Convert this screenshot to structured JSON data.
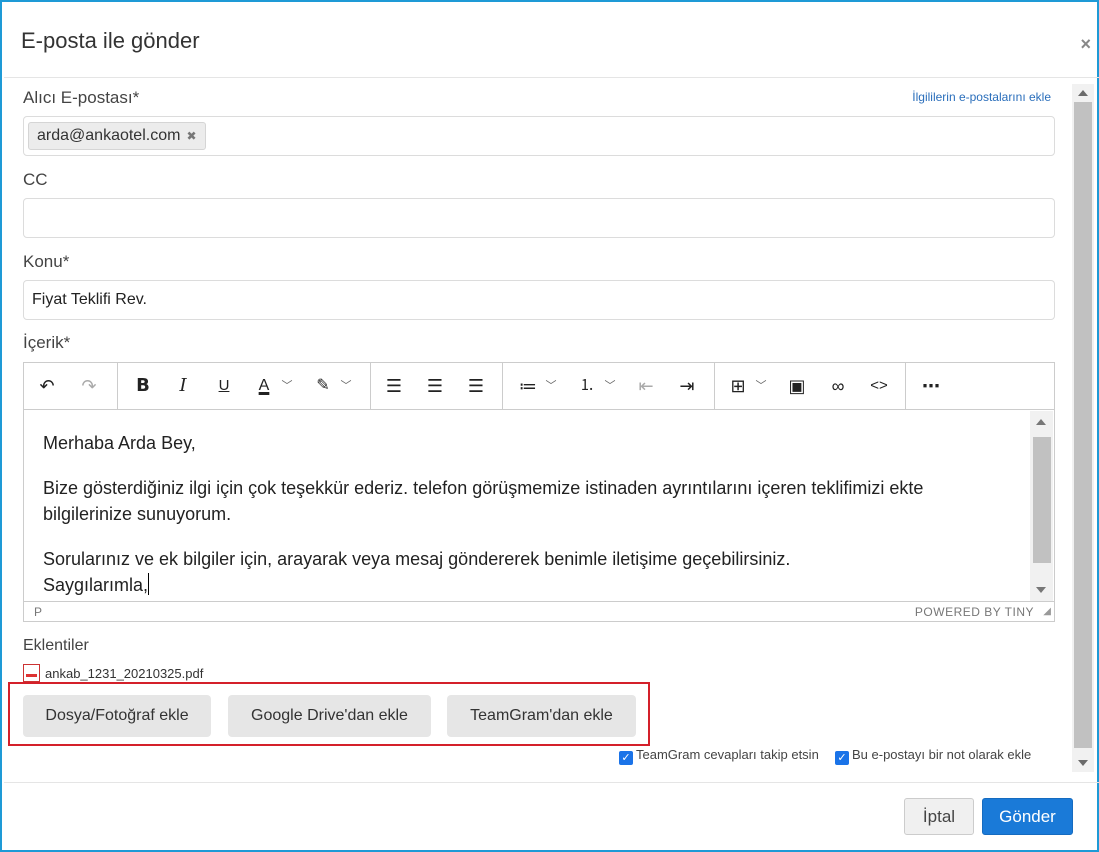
{
  "dialog": {
    "title": "E-posta ile gönder",
    "close_icon": "×"
  },
  "form": {
    "recipient_label": "Alıcı E-postası*",
    "add_related_link": "İlgililerin e-postalarını ekle",
    "recipient_chip": "arda@ankaotel.com",
    "recipient_chip_remove": "✖",
    "cc_label": "CC",
    "cc_value": "",
    "subject_label": "Konu*",
    "subject_value": "Fiyat Teklifi Rev.",
    "content_label": "İçerik*"
  },
  "editor": {
    "toolbar_icons": [
      "undo-icon",
      "redo-icon",
      "bold-icon",
      "italic-icon",
      "underline-icon",
      "text-color-icon",
      "highlight-icon",
      "align-left-icon",
      "align-center-icon",
      "align-right-icon",
      "bullet-list-icon",
      "numbered-list-icon",
      "outdent-icon",
      "indent-icon",
      "table-icon",
      "image-icon",
      "link-icon",
      "code-icon",
      "more-icon"
    ],
    "paragraphs": [
      "Merhaba Arda Bey,",
      "Bize gösterdiğiniz ilgi için çok teşekkür ederiz. telefon görüşmemize istinaden ayrıntılarını içeren teklifimizi ekte bilgilerinize sunuyorum."
    ],
    "closing_line1": "Sorularınız ve ek bilgiler için, arayarak veya mesaj göndererek benimle iletişime geçebilirsiniz.",
    "closing_line2": "Saygılarımla,",
    "status_path": "P",
    "powered_by": "POWERED BY TINY"
  },
  "attachments": {
    "label": "Eklentiler",
    "file_name": "ankab_1231_20210325.pdf",
    "buttons": {
      "file_photo": "Dosya/Fotoğraf ekle",
      "google_drive": "Google Drive'dan ekle",
      "teamgram": "TeamGram'dan ekle"
    }
  },
  "options": {
    "track_replies": "TeamGram cevapları takip etsin",
    "add_as_note": "Bu e-postayı bir not olarak ekle",
    "track_replies_checked": true,
    "add_as_note_checked": true
  },
  "footer": {
    "cancel": "İptal",
    "send": "Gönder"
  },
  "colors": {
    "accent": "#1a7ad8",
    "highlight_border": "#d4202a",
    "modal_border": "#1e9ad6"
  }
}
